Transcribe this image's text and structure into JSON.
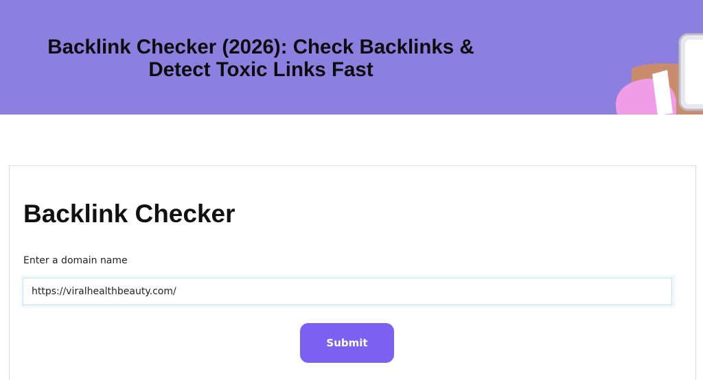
{
  "hero": {
    "title_line1": "Backlink Checker (2026): Check Backlinks &",
    "title_line2": "Detect Toxic Links Fast",
    "background_color": "#8d7fe0",
    "illustration": "hand-holding-phone-illustration"
  },
  "checker": {
    "title": "Backlink Checker",
    "field_label": "Enter a domain name",
    "domain_value": "https://viralhealthbeauty.com/",
    "submit_label": "Submit",
    "accent_color": "#7b61f2"
  }
}
